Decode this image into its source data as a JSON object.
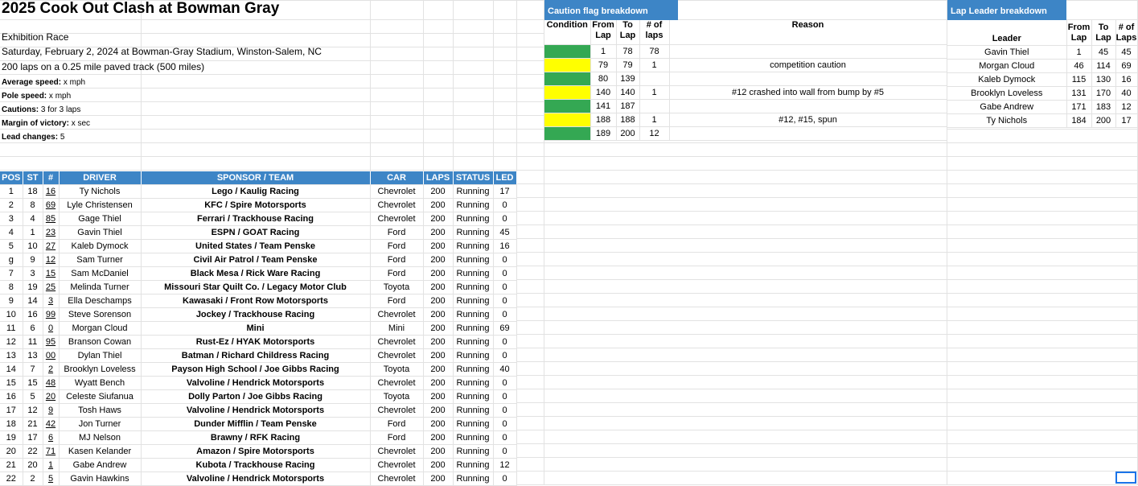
{
  "info": {
    "title": "2025 Cook Out Clash at Bowman Gray",
    "race_type": "Exhibition Race",
    "date_venue": "Saturday, February 2, 2024 at Bowman-Gray Stadium, Winston-Salem, NC",
    "distance": "200 laps on a 0.25 mile paved track (500 miles)",
    "avg_speed_label": "Average speed:",
    "avg_speed_value": "x mph",
    "pole_speed_label": "Pole speed:",
    "pole_speed_value": "x mph",
    "cautions_label": "Cautions:",
    "cautions_value": "3 for 3 laps",
    "margin_label": "Margin of victory:",
    "margin_value": "x sec",
    "lead_changes_label": "Lead changes:",
    "lead_changes_value": "5"
  },
  "results_headers": [
    "POS",
    "ST",
    "#",
    "DRIVER",
    "SPONSOR / TEAM",
    "CAR",
    "LAPS",
    "STATUS",
    "LED"
  ],
  "results": [
    [
      "1",
      "18",
      "16",
      "Ty Nichols",
      "Lego / Kaulig Racing",
      "Chevrolet",
      "200",
      "Running",
      "17"
    ],
    [
      "2",
      "8",
      "69",
      "Lyle Christensen",
      "KFC / Spire Motorsports",
      "Chevrolet",
      "200",
      "Running",
      "0"
    ],
    [
      "3",
      "4",
      "85",
      "Gage Thiel",
      "Ferrari / Trackhouse Racing",
      "Chevrolet",
      "200",
      "Running",
      "0"
    ],
    [
      "4",
      "1",
      "23",
      "Gavin Thiel",
      "ESPN / GOAT Racing",
      "Ford",
      "200",
      "Running",
      "45"
    ],
    [
      "5",
      "10",
      "27",
      "Kaleb Dymock",
      "United States / Team Penske",
      "Ford",
      "200",
      "Running",
      "16"
    ],
    [
      "g",
      "9",
      "12",
      "Sam Turner",
      "Civil Air Patrol / Team Penske",
      "Ford",
      "200",
      "Running",
      "0"
    ],
    [
      "7",
      "3",
      "15",
      "Sam McDaniel",
      "Black Mesa / Rick Ware Racing",
      "Ford",
      "200",
      "Running",
      "0"
    ],
    [
      "8",
      "19",
      "25",
      "Melinda Turner",
      "Missouri Star Quilt Co. / Legacy Motor Club",
      "Toyota",
      "200",
      "Running",
      "0"
    ],
    [
      "9",
      "14",
      "3",
      "Ella Deschamps",
      "Kawasaki / Front Row Motorsports",
      "Ford",
      "200",
      "Running",
      "0"
    ],
    [
      "10",
      "16",
      "99",
      "Steve Sorenson",
      "Jockey / Trackhouse Racing",
      "Chevrolet",
      "200",
      "Running",
      "0"
    ],
    [
      "11",
      "6",
      "0",
      "Morgan Cloud",
      "Mini",
      "Mini",
      "200",
      "Running",
      "69"
    ],
    [
      "12",
      "11",
      "95",
      "Branson Cowan",
      "Rust-Ez / HYAK Motorsports",
      "Chevrolet",
      "200",
      "Running",
      "0"
    ],
    [
      "13",
      "13",
      "00",
      "Dylan Thiel",
      "Batman / Richard Childress Racing",
      "Chevrolet",
      "200",
      "Running",
      "0"
    ],
    [
      "14",
      "7",
      "2",
      "Brooklyn Loveless",
      "Payson High School / Joe Gibbs Racing",
      "Toyota",
      "200",
      "Running",
      "40"
    ],
    [
      "15",
      "15",
      "48",
      "Wyatt Bench",
      "Valvoline / Hendrick Motorsports",
      "Chevrolet",
      "200",
      "Running",
      "0"
    ],
    [
      "16",
      "5",
      "20",
      "Celeste Siufanua",
      "Dolly Parton / Joe Gibbs Racing",
      "Toyota",
      "200",
      "Running",
      "0"
    ],
    [
      "17",
      "12",
      "9",
      "Tosh Haws",
      "Valvoline / Hendrick Motorsports",
      "Chevrolet",
      "200",
      "Running",
      "0"
    ],
    [
      "18",
      "21",
      "42",
      "Jon Turner",
      "Dunder Mifflin / Team Penske",
      "Ford",
      "200",
      "Running",
      "0"
    ],
    [
      "19",
      "17",
      "6",
      "MJ Nelson",
      "Brawny / RFK Racing",
      "Ford",
      "200",
      "Running",
      "0"
    ],
    [
      "20",
      "22",
      "71",
      "Kasen Kelander",
      "Amazon / Spire Motorsports",
      "Chevrolet",
      "200",
      "Running",
      "0"
    ],
    [
      "21",
      "20",
      "1",
      "Gabe Andrew",
      "Kubota / Trackhouse Racing",
      "Chevrolet",
      "200",
      "Running",
      "12"
    ],
    [
      "22",
      "2",
      "5",
      "Gavin Hawkins",
      "Valvoline / Hendrick Motorsports",
      "Chevrolet",
      "200",
      "Running",
      "0"
    ]
  ],
  "caution": {
    "title": "Caution flag breakdown",
    "h_condition": "Condition",
    "h_from_1": "From",
    "h_from_2": "Lap",
    "h_to_1": "To",
    "h_to_2": "Lap",
    "h_num_1": "# of",
    "h_num_2": "laps",
    "h_reason": "Reason",
    "rows": [
      {
        "flag": "#34a853",
        "from": "1",
        "to": "78",
        "laps": "78",
        "reason": ""
      },
      {
        "flag": "#ffff00",
        "from": "79",
        "to": "79",
        "laps": "1",
        "reason": "competition caution"
      },
      {
        "flag": "#34a853",
        "from": "80",
        "to": "139",
        "laps": "",
        "reason": ""
      },
      {
        "flag": "#ffff00",
        "from": "140",
        "to": "140",
        "laps": "1",
        "reason": "#12 crashed into wall from bump by #5"
      },
      {
        "flag": "#34a853",
        "from": "141",
        "to": "187",
        "laps": "",
        "reason": ""
      },
      {
        "flag": "#ffff00",
        "from": "188",
        "to": "188",
        "laps": "1",
        "reason": "#12, #15, spun"
      },
      {
        "flag": "#34a853",
        "from": "189",
        "to": "200",
        "laps": "12",
        "reason": ""
      }
    ]
  },
  "leaders": {
    "title": "Lap Leader breakdown",
    "h_leader": "Leader",
    "h_from_1": "From",
    "h_from_2": "Lap",
    "h_to_1": "To",
    "h_to_2": "Lap",
    "h_num_1": "# of",
    "h_num_2": "Laps",
    "rows": [
      [
        "Gavin Thiel",
        "1",
        "45",
        "45"
      ],
      [
        "Morgan Cloud",
        "46",
        "114",
        "69"
      ],
      [
        "Kaleb Dymock",
        "115",
        "130",
        "16"
      ],
      [
        "Brooklyn Loveless",
        "131",
        "170",
        "40"
      ],
      [
        "Gabe Andrew",
        "171",
        "183",
        "12"
      ],
      [
        "Ty Nichols",
        "184",
        "200",
        "17"
      ]
    ]
  },
  "colors": {
    "header_blue": "#3d85c6",
    "green_flag": "#34a853",
    "yellow_flag": "#ffff00"
  }
}
